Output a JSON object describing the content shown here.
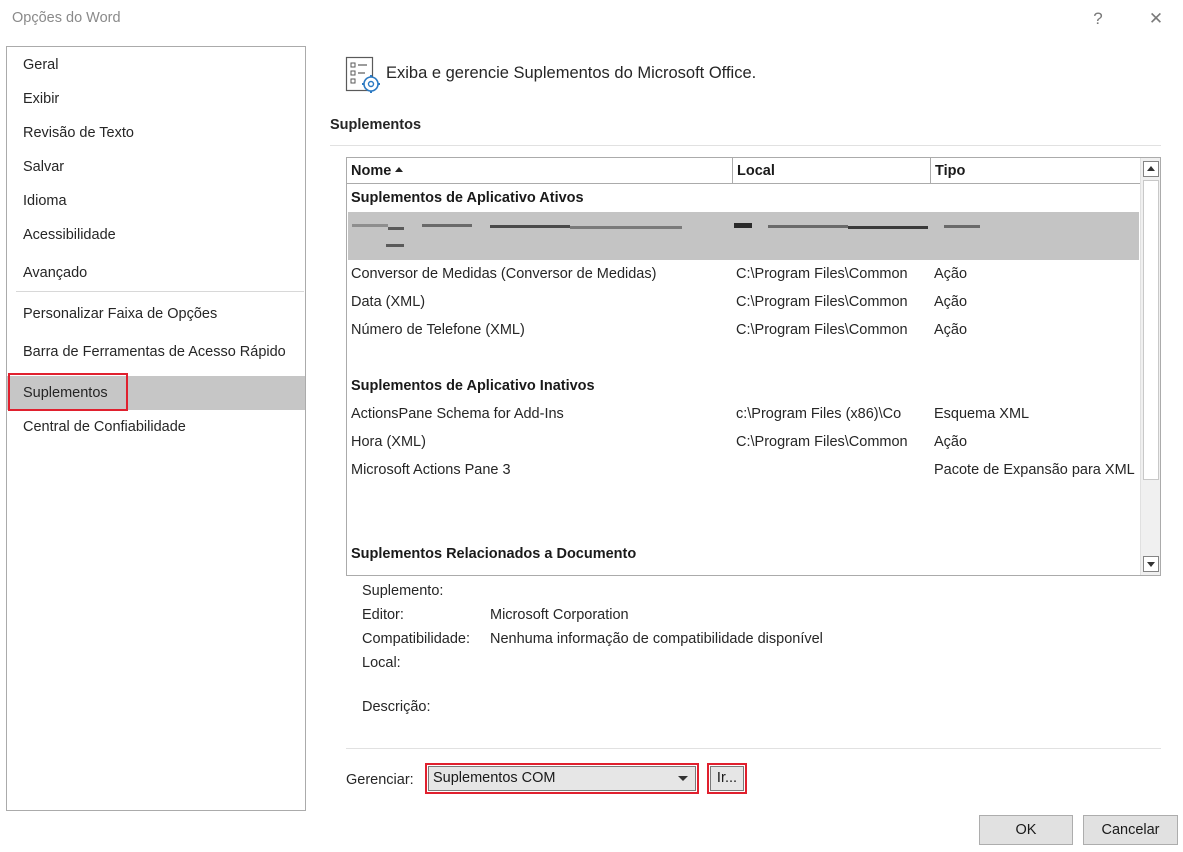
{
  "window": {
    "title": "Opções do Word",
    "help_label": "?",
    "close_label": "✕"
  },
  "sidebar": {
    "items": [
      {
        "label": "Geral"
      },
      {
        "label": "Exibir"
      },
      {
        "label": "Revisão de Texto"
      },
      {
        "label": "Salvar"
      },
      {
        "label": "Idioma"
      },
      {
        "label": "Acessibilidade"
      },
      {
        "label": "Avançado"
      },
      {
        "label": "Personalizar Faixa de Opções"
      },
      {
        "label": "Barra de Ferramentas de Acesso Rápido"
      },
      {
        "label": "Suplementos"
      },
      {
        "label": "Central de Confiabilidade"
      }
    ],
    "selected": "Suplementos"
  },
  "header": {
    "text": "Exiba e gerencie Suplementos do Microsoft Office.",
    "icon": "addins-settings-icon"
  },
  "section": {
    "title": "Suplementos"
  },
  "table": {
    "columns": [
      "Nome",
      "Local",
      "Tipo"
    ],
    "sort_column": "Nome",
    "groups": [
      {
        "title": "Suplementos de Aplicativo Ativos"
      },
      {
        "title": "Suplementos de Aplicativo Inativos"
      },
      {
        "title": "Suplementos Relacionados a Documento"
      }
    ],
    "active_rows": [
      {
        "name": "Conversor de Medidas (Conversor de Medidas)",
        "location": "C:\\Program Files\\Common",
        "type": "Ação"
      },
      {
        "name": "Data (XML)",
        "location": "C:\\Program Files\\Common",
        "type": "Ação"
      },
      {
        "name": "Número de Telefone (XML)",
        "location": "C:\\Program Files\\Common",
        "type": "Ação"
      }
    ],
    "inactive_rows": [
      {
        "name": "ActionsPane Schema for Add-Ins",
        "location": "c:\\Program Files (x86)\\Co",
        "type": "Esquema XML"
      },
      {
        "name": "Hora (XML)",
        "location": "C:\\Program Files\\Common",
        "type": "Ação"
      },
      {
        "name": "Microsoft Actions Pane 3",
        "location": "",
        "type": "Pacote de Expansão para XML"
      }
    ]
  },
  "details": {
    "addin_label": "Suplemento:",
    "addin_value": "",
    "publisher_label": "Editor:",
    "publisher_value": "Microsoft Corporation",
    "compat_label": "Compatibilidade:",
    "compat_value": "Nenhuma informação de compatibilidade disponível",
    "location_label": "Local:",
    "location_value": "",
    "description_label": "Descrição:",
    "description_value": ""
  },
  "manage": {
    "label": "Gerenciar:",
    "selected": "Suplementos COM",
    "go_label": "Ir..."
  },
  "buttons": {
    "ok": "OK",
    "cancel": "Cancelar"
  },
  "colors": {
    "highlight_red": "#e0202e",
    "selected_gray": "#c6c6c6"
  }
}
